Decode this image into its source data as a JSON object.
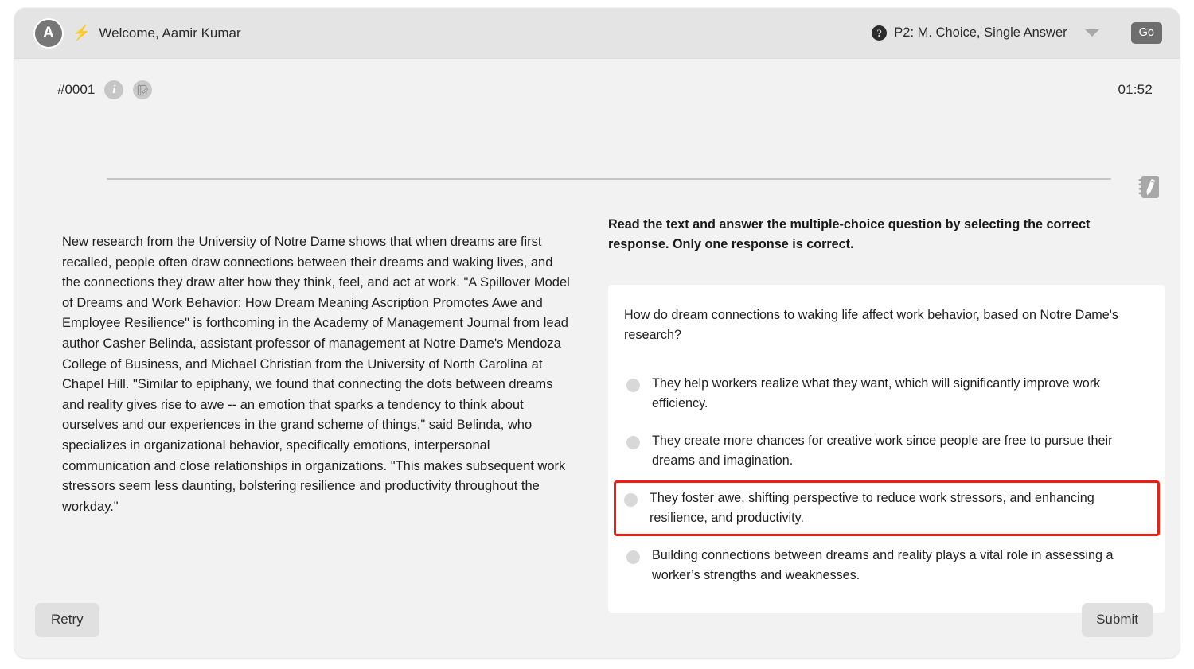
{
  "header": {
    "avatar_initial": "A",
    "bolt_icon": "bolt-icon",
    "welcome": "Welcome, Aamir Kumar",
    "help_icon": "?",
    "mode_label": "P2: M. Choice, Single Answer",
    "go_label": "Go"
  },
  "meta": {
    "question_number": "#0001",
    "info_icon_glyph": "i",
    "note_icon": "note-edit-icon",
    "timer": "01:52",
    "notepad_icon": "notepad-pencil-icon"
  },
  "passage": {
    "text": "New research from the University of Notre Dame shows that when dreams are first recalled, people often draw connections between their dreams and waking lives, and the connections they draw alter how they think, feel, and act at work. \"A Spillover Model of Dreams and Work Behavior: How Dream Meaning Ascription Promotes Awe and Employee Resilience\" is forthcoming in the Academy of Management Journal from lead author Casher Belinda, assistant professor of management at Notre Dame's Mendoza College of Business, and Michael Christian from the University of North Carolina at Chapel Hill. \"Similar to epiphany, we found that connecting the dots between dreams and reality gives rise to awe -- an emotion that sparks a tendency to think about ourselves and our experiences in the grand scheme of things,\" said Belinda, who specializes in organizational behavior, specifically emotions, interpersonal communication and close relationships in organizations. \"This makes subsequent work stressors seem less daunting, bolstering resilience and productivity throughout the workday.\""
  },
  "question": {
    "instructions": "Read the text and answer the multiple-choice question by selecting the correct response. Only one response is correct.",
    "stem": "How do dream connections to waking life affect work behavior, based on Notre Dame's research?",
    "options": [
      "They help workers realize what they want, which will significantly improve work efficiency.",
      "They create more chances for creative work since people are free to pursue their dreams and imagination.",
      "They foster awe, shifting perspective to reduce work stressors, and enhancing resilience, and productivity.",
      "Building connections between dreams and reality plays a vital role in assessing a worker’s strengths and weaknesses."
    ],
    "highlighted_index": 2,
    "highlight_color": "#f01e10"
  },
  "footer": {
    "retry_label": "Retry",
    "submit_label": "Submit"
  }
}
